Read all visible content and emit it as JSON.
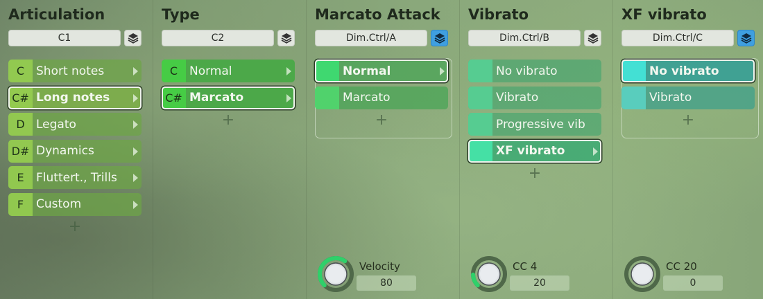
{
  "columns": [
    {
      "title": "Articulation",
      "selector": "C1",
      "items": [
        {
          "key": "C",
          "label": "Short notes"
        },
        {
          "key": "C#",
          "label": "Long notes"
        },
        {
          "key": "D",
          "label": "Legato"
        },
        {
          "key": "D#",
          "label": "Dynamics"
        },
        {
          "key": "E",
          "label": "Fluttert., Trills"
        },
        {
          "key": "F",
          "label": "Custom"
        }
      ]
    },
    {
      "title": "Type",
      "selector": "C2",
      "items": [
        {
          "key": "C",
          "label": "Normal"
        },
        {
          "key": "C#",
          "label": "Marcato"
        }
      ]
    },
    {
      "title": "Marcato Attack",
      "selector": "Dim.Ctrl/A",
      "items": [
        {
          "label": "Normal"
        },
        {
          "label": "Marcato"
        }
      ],
      "knob": {
        "label": "Velocity",
        "value": "80",
        "level": 0.63
      }
    },
    {
      "title": "Vibrato",
      "selector": "Dim.Ctrl/B",
      "items": [
        {
          "label": "No vibrato"
        },
        {
          "label": "Vibrato"
        },
        {
          "label": "Progressive vib"
        },
        {
          "label": "XF vibrato"
        }
      ],
      "knob": {
        "label": "CC 4",
        "value": "20",
        "level": 0.16
      }
    },
    {
      "title": "XF vibrato",
      "selector": "Dim.Ctrl/C",
      "items": [
        {
          "label": "No vibrato"
        },
        {
          "label": "Vibrato"
        }
      ],
      "knob": {
        "label": "CC 20",
        "value": "0",
        "level": 0.0
      }
    }
  ],
  "add_symbol": "+",
  "colors": {
    "layer_active": "#3f9fe0",
    "knob_arc": "#2fd06a"
  },
  "icons": {
    "layer": "layers-icon",
    "arrow": "chevron-right-icon",
    "add": "plus-icon"
  }
}
